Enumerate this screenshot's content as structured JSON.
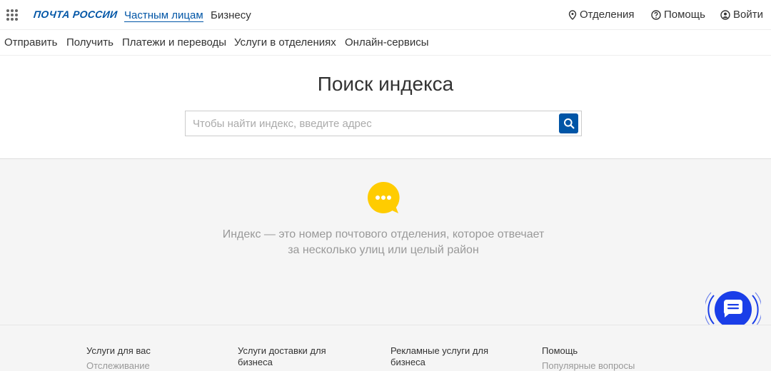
{
  "header": {
    "logo": "ПОЧТА РОССИИ",
    "segments": [
      {
        "label": "Частным лицам",
        "active": true
      },
      {
        "label": "Бизнесу",
        "active": false
      }
    ],
    "right": {
      "offices": "Отделения",
      "help": "Помощь",
      "login": "Войти"
    }
  },
  "subnav": [
    "Отправить",
    "Получить",
    "Платежи и переводы",
    "Услуги в отделениях",
    "Онлайн-сервисы"
  ],
  "search": {
    "title": "Поиск индекса",
    "placeholder": "Чтобы найти индекс, введите адрес"
  },
  "info": {
    "line1": "Индекс — это номер почтового отделения, которое отвечает",
    "line2": "за несколько улиц или целый район"
  },
  "footer": {
    "columns": [
      {
        "title_line1": "Услуги для вас",
        "title_line2": "",
        "link": "Отслеживание"
      },
      {
        "title_line1": "Услуги доставки для",
        "title_line2": "бизнеса",
        "link": ""
      },
      {
        "title_line1": "Рекламные услуги для",
        "title_line2": "бизнеса",
        "link": ""
      },
      {
        "title_line1": "Помощь",
        "title_line2": "",
        "link": "Популярные вопросы"
      }
    ]
  },
  "colors": {
    "brand": "#0055a6",
    "chat": "#1a3ee8",
    "info_icon": "#ffcc00"
  },
  "icons": [
    "apps-grid-icon",
    "map-pin-icon",
    "question-circle-icon",
    "user-circle-icon",
    "search-icon",
    "speech-bubble-icon",
    "chat-icon"
  ]
}
